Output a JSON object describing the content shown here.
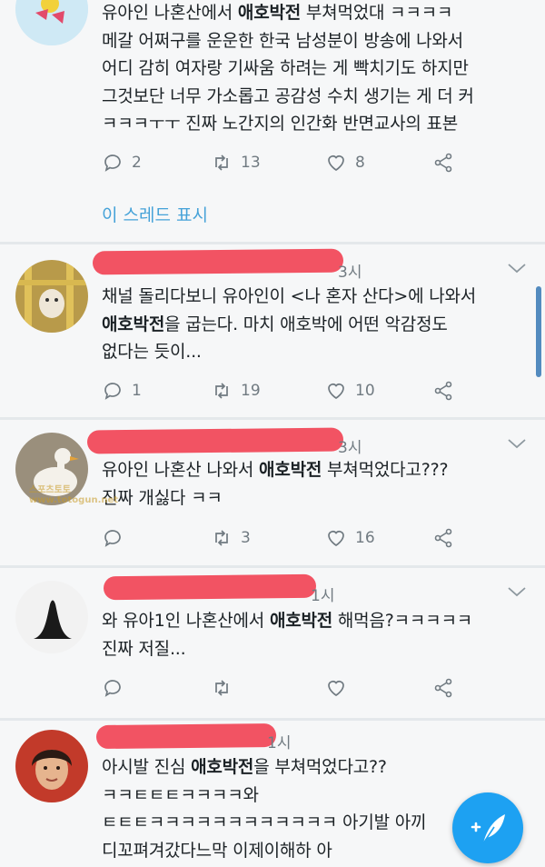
{
  "thread_link": "이 스레드 표시",
  "watermark": {
    "brand": "스포츠토토",
    "url": "www.totogun.net"
  },
  "tweets": [
    {
      "lines": [
        [
          {
            "t": "유아인 나혼산에서 "
          },
          {
            "t": "애호박전",
            "b": true
          },
          {
            "t": " 부쳐먹었대 ㅋㅋㅋㅋ"
          }
        ],
        [
          {
            "t": "메갈 어쩌구를 운운한 한국 남성분이 방송에 나와서"
          }
        ],
        [
          {
            "t": "어디 감히 여자랑 기싸움 하려는 게 빡치기도 하지만"
          }
        ],
        [
          {
            "t": "그것보단 너무 가소롭고 공감성 수치 생기는 게 더 커"
          }
        ],
        [
          {
            "t": "ㅋㅋㅋㅜㅜ 진짜 노간지의 인간화 반면교사의 표본"
          }
        ]
      ],
      "reply_count": "2",
      "retweet_count": "13",
      "like_count": "8"
    },
    {
      "time": "3시",
      "lines": [
        [
          {
            "t": "채널 돌리다보니 유아인이 <나 혼자 산다>에 나와서"
          }
        ],
        [
          {
            "t": "애호박전",
            "b": true
          },
          {
            "t": "을 굽는다. 마치 애호박에 어떤 악감정도"
          }
        ],
        [
          {
            "t": "없다는 듯이..."
          }
        ]
      ],
      "reply_count": "1",
      "retweet_count": "19",
      "like_count": "10"
    },
    {
      "time": "3시",
      "lines": [
        [
          {
            "t": "유아인 나혼산 나와서 "
          },
          {
            "t": "애호박전",
            "b": true
          },
          {
            "t": " 부쳐먹었다고???"
          }
        ],
        [
          {
            "t": "진짜 개싫다 ㅋㅋ"
          }
        ]
      ],
      "reply_count": "",
      "retweet_count": "3",
      "like_count": "16"
    },
    {
      "time": "1시",
      "lines": [
        [
          {
            "t": "와 유아1인 나혼산에서 "
          },
          {
            "t": "애호박전",
            "b": true
          },
          {
            "t": " 해먹음?ㅋㅋㅋㅋㅋ"
          }
        ],
        [
          {
            "t": "진짜 저질..."
          }
        ]
      ],
      "reply_count": "",
      "retweet_count": "",
      "like_count": ""
    },
    {
      "time": "1시",
      "lines": [
        [
          {
            "t": "아시발 진심 "
          },
          {
            "t": "애호박전",
            "b": true
          },
          {
            "t": "을 부쳐먹었다고??"
          }
        ],
        [
          {
            "t": "ㅋㅋㅌㅌㅌㅋㅋㅋㅋ와"
          }
        ],
        [
          {
            "t": "ㅌㅌㅌㅋㅋㅋㅋㅋㅋㅋㅋㅋㅋㅋㅋ 아기발 아끼"
          }
        ],
        [
          {
            "t": "디꼬펴겨갔다느막 이제이해하 아"
          }
        ]
      ]
    }
  ]
}
